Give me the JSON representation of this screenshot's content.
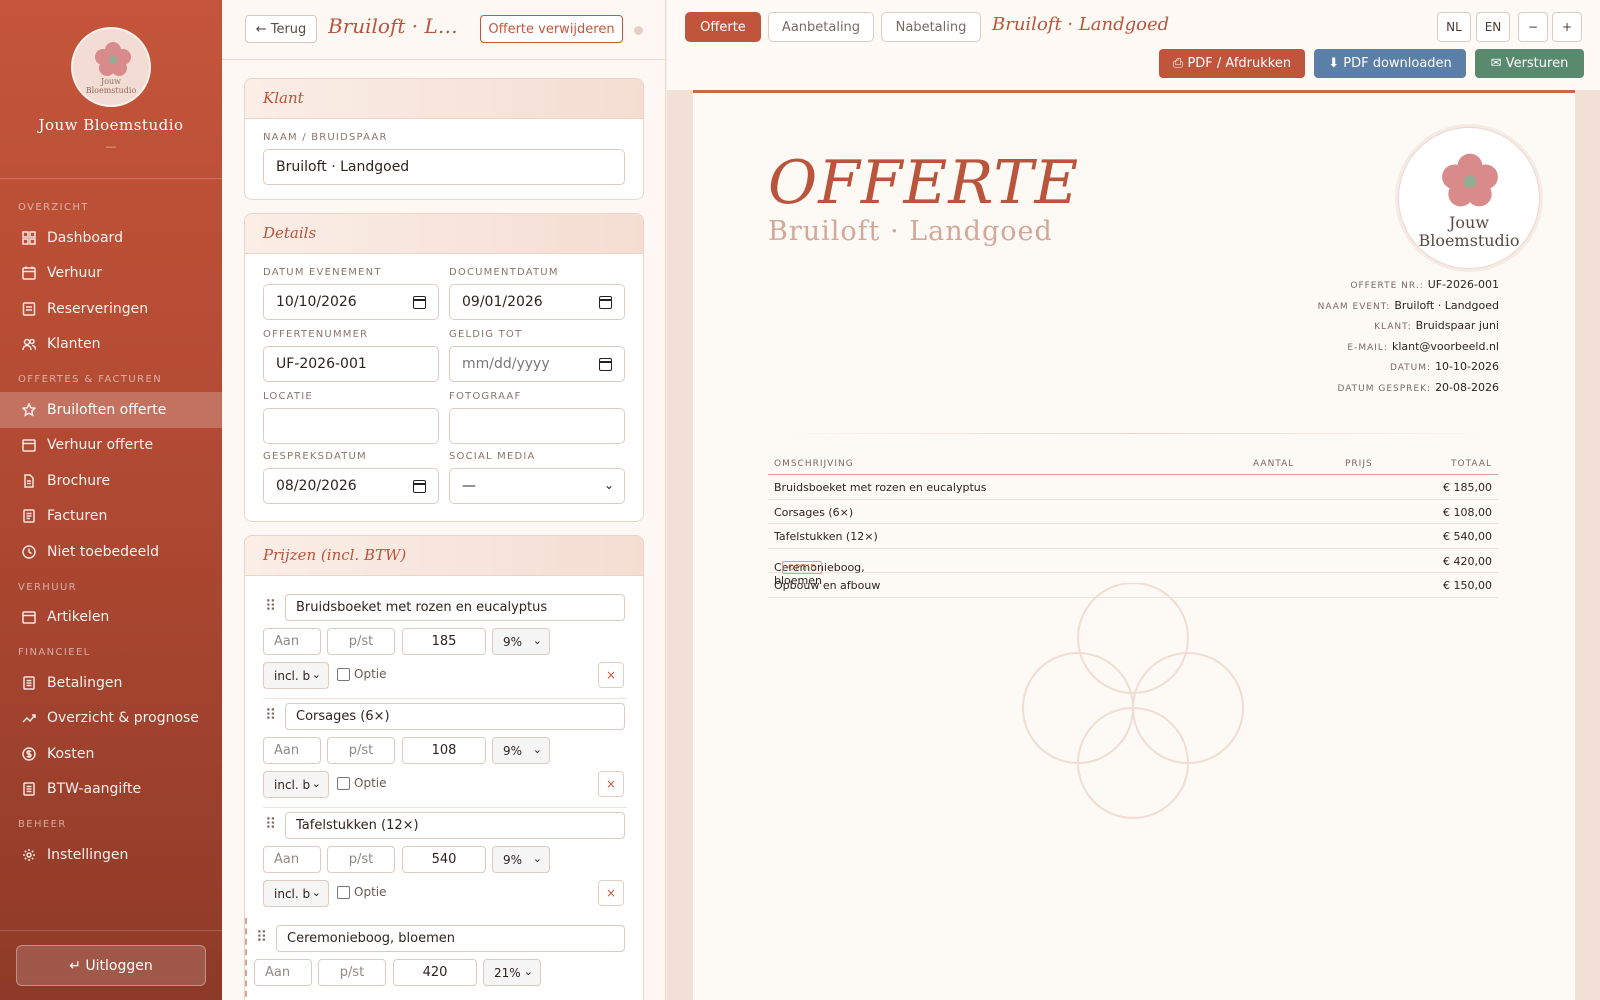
{
  "sidebar": {
    "logo_text": "Jouw\nBloemstudio",
    "brand": "Jouw Bloemstudio",
    "brand_sub": "—",
    "sections": {
      "overzicht": "OVERZICHT",
      "offertes": "OFFERTES & FACTUREN",
      "verhuur": "VERHUUR",
      "financieel": "FINANCIEEL",
      "beheer": "BEHEER"
    },
    "items": {
      "dashboard": "Dashboard",
      "verhuur": "Verhuur",
      "reserveringen": "Reserveringen",
      "klanten": "Klanten",
      "bruiloften": "Bruiloften offerte",
      "verhuur_offerte": "Verhuur offerte",
      "brochure": "Brochure",
      "facturen": "Facturen",
      "niet_toebedeeld": "Niet toebedeeld",
      "artikelen": "Artikelen",
      "betalingen": "Betalingen",
      "overzicht_prognose": "Overzicht & prognose",
      "kosten": "Kosten",
      "btw": "BTW-aangifte",
      "instellingen": "Instellingen"
    },
    "logout": "↵ Uitloggen"
  },
  "editor": {
    "back": "← Terug",
    "title": "Bruiloft · Landgoed",
    "delete": "Offerte verwijderen",
    "klant": {
      "heading": "Klant",
      "naam_label": "NAAM / BRUIDSPAAR",
      "naam_value": "Bruiloft · Landgoed"
    },
    "details": {
      "heading": "Details",
      "datum_event_label": "DATUM EVENEMENT",
      "datum_event_value": "10/10/2026",
      "documentdatum_label": "DOCUMENTDATUM",
      "documentdatum_value": "09/01/2026",
      "offertenummer_label": "OFFERTENUMMER",
      "offertenummer_value": "UF-2026-001",
      "geldig_tot_label": "GELDIG TOT",
      "geldig_tot_value": "mm/dd/yyyy",
      "locatie_label": "LOCATIE",
      "fotograaf_label": "FOTOGRAAF",
      "gespreksdatum_label": "GESPREKSDATUM",
      "gespreksdatum_value": "08/20/2026",
      "social_label": "SOCIAL MEDIA",
      "social_value": "—"
    },
    "prijzen": {
      "heading": "Prijzen (incl. BTW)",
      "qty_placeholder": "Aan",
      "unit_placeholder": "p/st",
      "incl_label": "incl. b",
      "optie_label": "Optie",
      "remove": "×",
      "rows": [
        {
          "desc": "Bruidsboeket met rozen en eucalyptus",
          "price": "185",
          "vat": "9%"
        },
        {
          "desc": "Corsages (6×)",
          "price": "108",
          "vat": "9%"
        },
        {
          "desc": "Tafelstukken (12×)",
          "price": "540",
          "vat": "9%"
        },
        {
          "desc": "Ceremonieboog, bloemen",
          "price": "420",
          "vat": "21%"
        }
      ]
    }
  },
  "preview": {
    "tabs": {
      "offerte": "Offerte",
      "aanbetaling": "Aanbetaling",
      "nabetaling": "Nabetaling"
    },
    "title": "Bruiloft · Landgoed",
    "lang_nl": "NL",
    "lang_en": "EN",
    "zoom_out": "−",
    "zoom_in": "+",
    "print": "⎙ PDF / Afdrukken",
    "download": "⬇ PDF downloaden",
    "send": "✉ Versturen",
    "colors": {
      "accent": "#c0553c",
      "download": "#5b7fa6",
      "send": "#5a8a6e"
    },
    "doc": {
      "heading": "OFFERTE",
      "subheading": "Bruiloft · Landgoed",
      "logo_name": "Jouw\nBloemstudio",
      "meta": [
        {
          "k": "OFFERTE NR.:",
          "v": "UF-2026-001"
        },
        {
          "k": "NAAM EVENT:",
          "v": "Bruiloft · Landgoed"
        },
        {
          "k": "KLANT:",
          "v": "Bruidspaar juni"
        },
        {
          "k": "E-MAIL:",
          "v": "klant@voorbeeld.nl"
        },
        {
          "k": "DATUM:",
          "v": "10-10-2026"
        },
        {
          "k": "DATUM GESPREK:",
          "v": "20-08-2026"
        }
      ],
      "table": {
        "headers": {
          "desc": "OMSCHRIJVING",
          "qty": "AANTAL",
          "price": "PRIJS",
          "total": "TOTAAL"
        },
        "option_badge": "OPTIE",
        "rows": [
          {
            "desc": "Bruidsboeket met rozen en eucalyptus",
            "total": "€ 185,00"
          },
          {
            "desc": "Corsages (6×)",
            "total": "€ 108,00"
          },
          {
            "desc": "Tafelstukken (12×)",
            "total": "€ 540,00"
          },
          {
            "desc": "Ceremonieboog, bloemen",
            "total": "€ 420,00"
          },
          {
            "desc": "Opbouw en afbouw",
            "total": "€ 150,00"
          }
        ]
      }
    }
  }
}
